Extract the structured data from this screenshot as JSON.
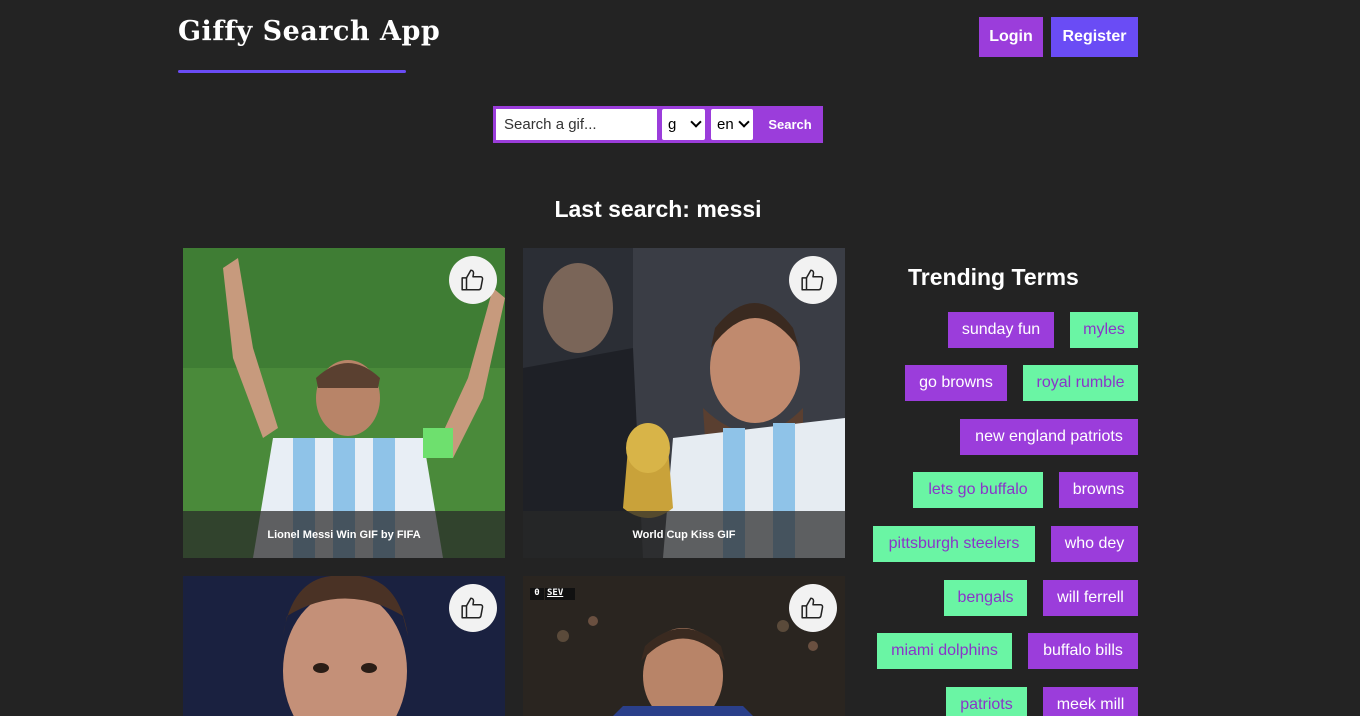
{
  "header": {
    "app_title": "Giffy Search App",
    "login_label": "Login",
    "register_label": "Register"
  },
  "search": {
    "placeholder": "Search a gif...",
    "value": "",
    "rating_selected": "g",
    "language_selected": "en",
    "button_label": "Search"
  },
  "results": {
    "heading": "Last search: messi",
    "cards": [
      {
        "caption": "Lionel Messi Win GIF by FIFA"
      },
      {
        "caption": "World Cup Kiss GIF"
      },
      {
        "caption": ""
      },
      {
        "caption": "",
        "score_overlay_home": "0",
        "score_overlay_team": "SEV"
      }
    ]
  },
  "trending": {
    "title": "Trending Terms",
    "terms": [
      "sunday fun",
      "myles",
      "go browns",
      "royal rumble",
      "new england patriots",
      "lets go buffalo",
      "browns",
      "pittsburgh steelers",
      "who dey",
      "bengals",
      "will ferrell",
      "miami dolphins",
      "buffalo bills",
      "patriots",
      "meek mill"
    ]
  },
  "colors": {
    "background": "#232323",
    "accent_purple": "#9b3ddb",
    "accent_indigo": "#6a4cf5",
    "accent_green": "#6af5a4"
  }
}
